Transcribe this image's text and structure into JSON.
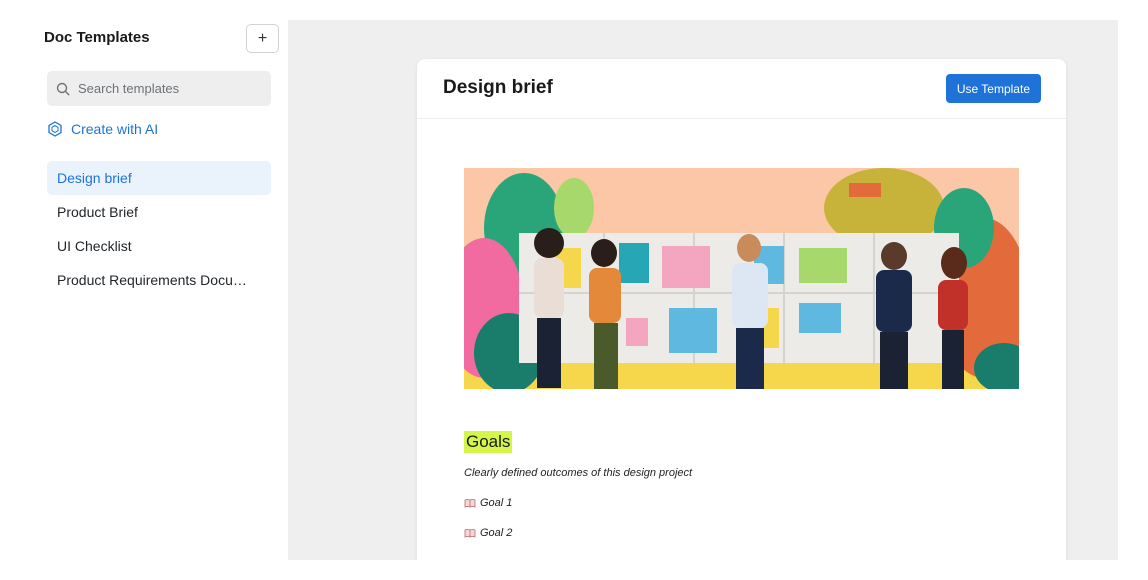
{
  "sidebar": {
    "title": "Doc Templates",
    "add_label": "+",
    "search_placeholder": "Search templates",
    "create_ai_label": "Create with AI",
    "templates": [
      {
        "label": "Design brief",
        "active": true
      },
      {
        "label": "Product Brief",
        "active": false
      },
      {
        "label": "UI Checklist",
        "active": false
      },
      {
        "label": "Product Requirements Document",
        "active": false
      }
    ]
  },
  "preview": {
    "title": "Design brief",
    "use_button_label": "Use Template",
    "goals_heading": "Goals",
    "goals_description": "Clearly defined outcomes of this design project",
    "goals": [
      "Goal 1",
      "Goal 2"
    ]
  },
  "colors": {
    "accent": "#1f73d8",
    "active_bg": "#eaf3fc",
    "highlight": "#d6f54a"
  }
}
